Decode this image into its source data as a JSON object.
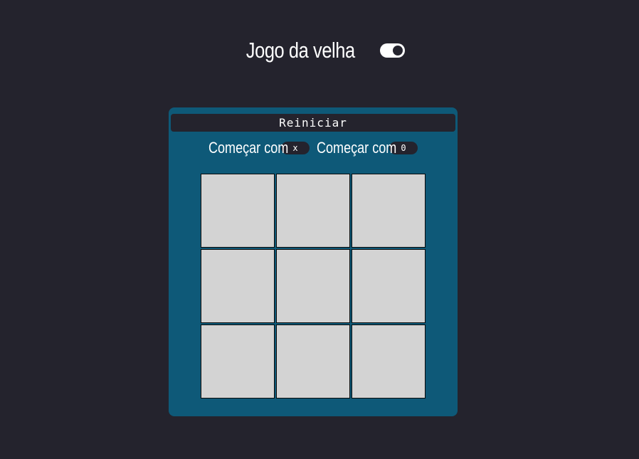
{
  "header": {
    "title": "Jogo da velha",
    "theme_toggle_icon": "toggle-switch"
  },
  "controls": {
    "restart_label": "Reiniciar",
    "start_with": [
      {
        "label": "Começar com",
        "value": "x"
      },
      {
        "label": "Começar com",
        "value": "0"
      }
    ]
  },
  "board": {
    "cells": [
      "",
      "",
      "",
      "",
      "",
      "",
      "",
      "",
      ""
    ]
  },
  "colors": {
    "background": "#24232d",
    "panel": "#0e5978",
    "cell": "#d3d3d3",
    "button": "#24232d",
    "text": "#ffffff"
  }
}
